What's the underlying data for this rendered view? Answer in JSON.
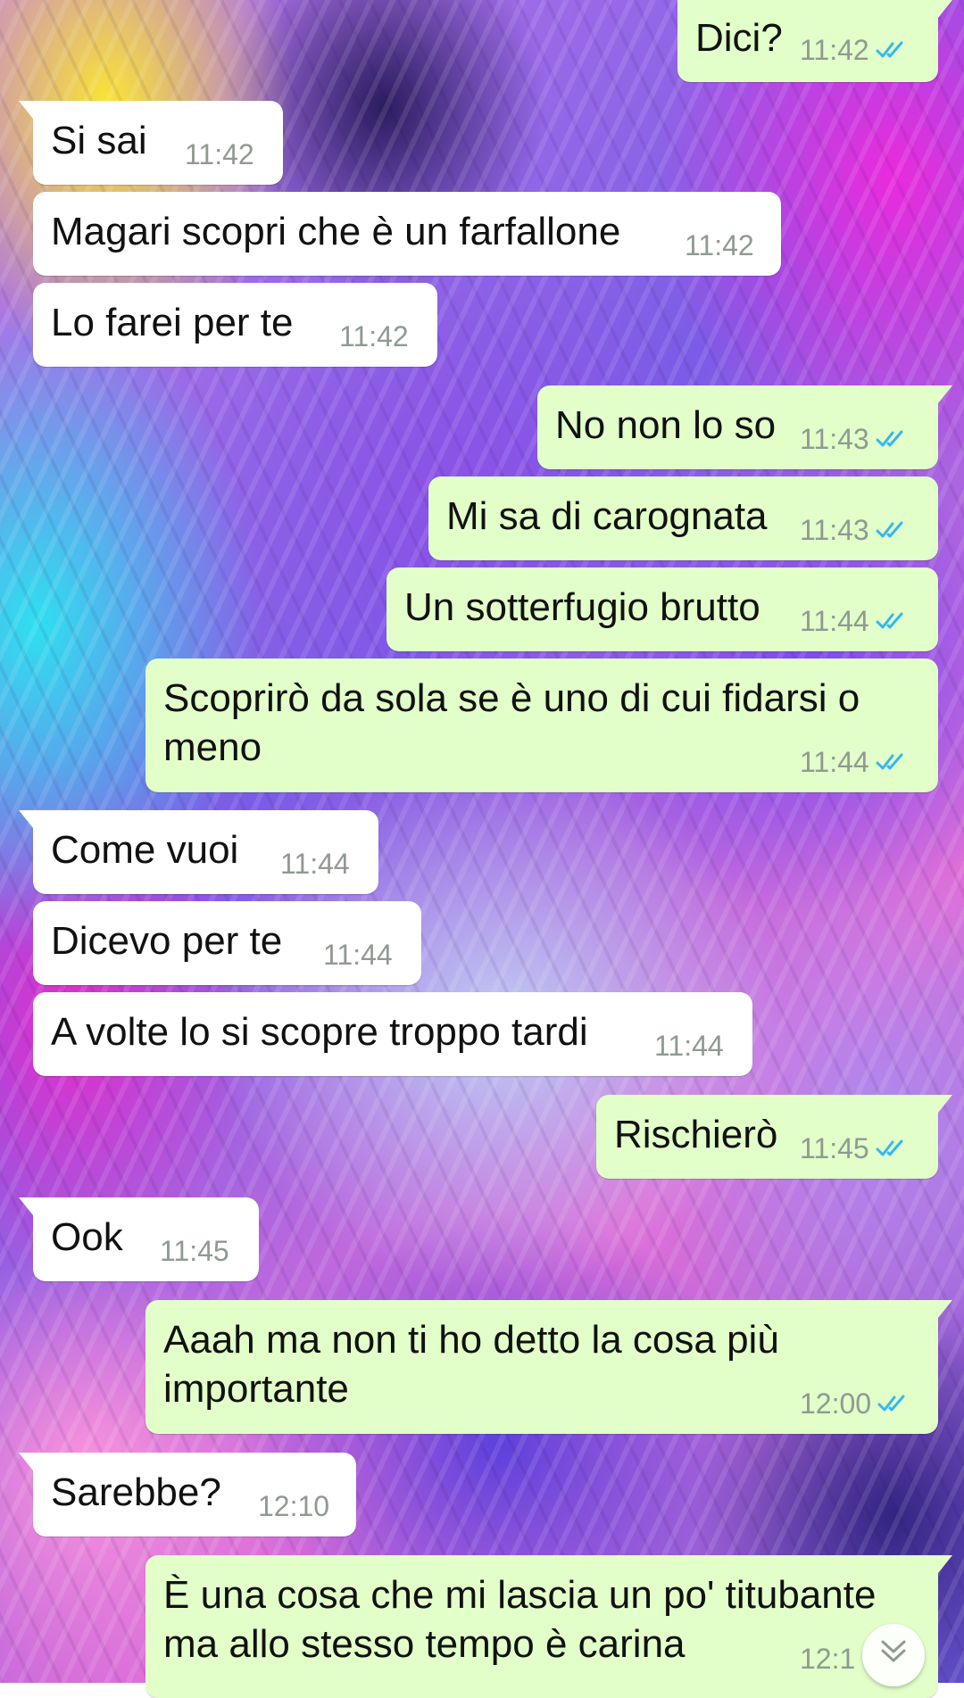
{
  "chat": {
    "messages": [
      {
        "direction": "out",
        "text": "Dici?",
        "time": "11:42",
        "status": "read"
      },
      {
        "direction": "in",
        "text": "Si sai",
        "time": "11:42"
      },
      {
        "direction": "in",
        "text": "Magari scopri che è un farfallone",
        "time": "11:42"
      },
      {
        "direction": "in",
        "text": "Lo farei per te",
        "time": "11:42"
      },
      {
        "direction": "out",
        "text": "No non lo so",
        "time": "11:43",
        "status": "read"
      },
      {
        "direction": "out",
        "text": "Mi sa di carognata",
        "time": "11:43",
        "status": "read"
      },
      {
        "direction": "out",
        "text": "Un sotterfugio brutto",
        "time": "11:44",
        "status": "read"
      },
      {
        "direction": "out",
        "line1": "Scoprirò da sola se è uno di cui fidarsi o",
        "line2": "meno",
        "time": "11:44",
        "status": "read"
      },
      {
        "direction": "in",
        "text": "Come vuoi",
        "time": "11:44"
      },
      {
        "direction": "in",
        "text": "Dicevo per te",
        "time": "11:44"
      },
      {
        "direction": "in",
        "text": "A volte lo si scopre troppo tardi",
        "time": "11:44"
      },
      {
        "direction": "out",
        "text": "Rischierò",
        "time": "11:45",
        "status": "read"
      },
      {
        "direction": "in",
        "text": "Ook",
        "time": "11:45"
      },
      {
        "direction": "out",
        "line1": "Aaah ma non ti ho detto la cosa più",
        "line2": "importante",
        "time": "12:00",
        "status": "read"
      },
      {
        "direction": "in",
        "text": "Sarebbe?",
        "time": "12:10"
      },
      {
        "direction": "out",
        "line1": "È una cosa che mi lascia un po' titubante",
        "line2": "ma allo stesso tempo è carina",
        "time": "12:1"
      }
    ]
  },
  "colors": {
    "incoming_bubble": "#ffffff",
    "outgoing_bubble": "#e2fec9",
    "timestamp": "#8e9a92",
    "read_ticks": "#34b7f1"
  },
  "icons": {
    "read_receipt": "double-check-icon",
    "scroll_down": "chevron-double-down-icon"
  }
}
